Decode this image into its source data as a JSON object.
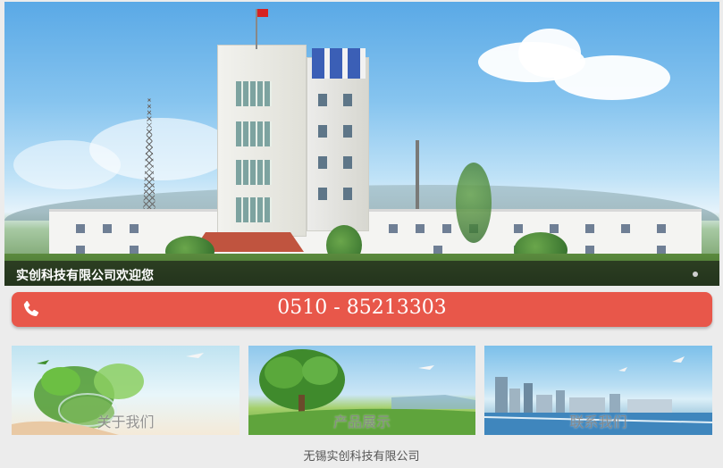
{
  "banner": {
    "caption": "实创科技有限公司欢迎您",
    "slide_count": 1
  },
  "contact": {
    "phone_icon": "phone-icon",
    "phone_number": "0510 - 85213303",
    "bar_color": "#e8574a"
  },
  "nav": {
    "tiles": [
      {
        "label": "关于我们",
        "image": "plants-on-hand-image"
      },
      {
        "label": "产品展示",
        "image": "tree-on-meadow-image"
      },
      {
        "label": "联系我们",
        "image": "city-skyline-image"
      }
    ]
  },
  "footer": {
    "company": "无锡实创科技有限公司"
  }
}
